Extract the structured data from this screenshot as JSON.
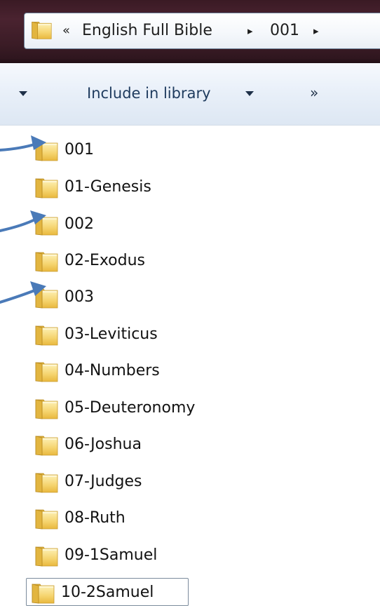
{
  "address_bar": {
    "overflow_icon": "«",
    "crumbs": [
      "English Full Bible",
      "001"
    ],
    "separator_icon": "▸"
  },
  "toolbar": {
    "include_in_library_label": "Include in library",
    "more_icon": "»"
  },
  "folders": [
    {
      "name": "001",
      "annotated": true
    },
    {
      "name": "01-Genesis",
      "annotated": false
    },
    {
      "name": "002",
      "annotated": true
    },
    {
      "name": "02-Exodus",
      "annotated": false
    },
    {
      "name": "003",
      "annotated": true
    },
    {
      "name": "03-Leviticus",
      "annotated": false
    },
    {
      "name": "04-Numbers",
      "annotated": false
    },
    {
      "name": "05-Deuteronomy",
      "annotated": false
    },
    {
      "name": "06-Joshua",
      "annotated": false
    },
    {
      "name": "07-Judges",
      "annotated": false
    },
    {
      "name": "08-Ruth",
      "annotated": false
    },
    {
      "name": "09-1Samuel",
      "annotated": false
    },
    {
      "name": "10-2Samuel",
      "annotated": false,
      "selected": true
    }
  ],
  "colors": {
    "annotation_arrow": "#4a7ab8",
    "folder_yellow": "#f2cc5a",
    "titlebar": "#3a1a24",
    "toolbar_text": "#1e3b5e"
  },
  "icons": {
    "folder": "folder-icon",
    "arrow": "annotation-arrow"
  }
}
